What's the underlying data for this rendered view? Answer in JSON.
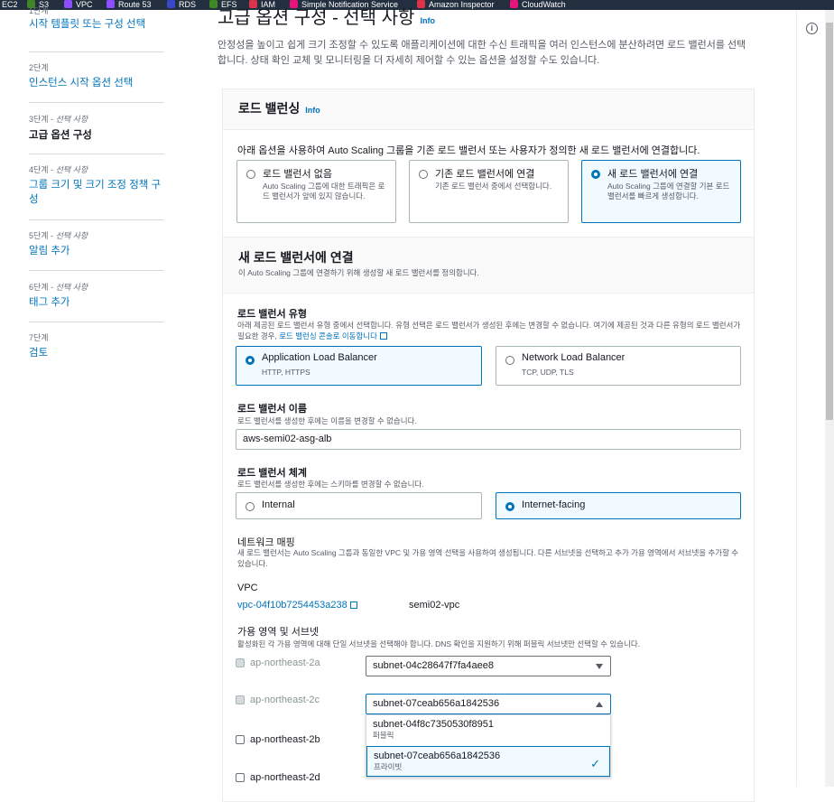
{
  "topbar": {
    "services": [
      {
        "name": "EC2",
        "color": "#ed7100"
      },
      {
        "name": "S3",
        "color": "#3f8624"
      },
      {
        "name": "VPC",
        "color": "#8c4fff"
      },
      {
        "name": "Route 53",
        "color": "#8c4fff"
      },
      {
        "name": "RDS",
        "color": "#3b48cc"
      },
      {
        "name": "EFS",
        "color": "#3f8624"
      },
      {
        "name": "IAM",
        "color": "#dd344c"
      },
      {
        "name": "Simple Notification Service",
        "color": "#e7157b"
      },
      {
        "name": "Amazon Inspector",
        "color": "#dd344c"
      },
      {
        "name": "CloudWatch",
        "color": "#e7157b"
      }
    ]
  },
  "sidebar": {
    "steps": [
      {
        "num": "1단계",
        "label": "시작 템플릿 또는 구성 선택"
      },
      {
        "num": "2단계",
        "label": "인스턴스 시작 옵션 선택"
      },
      {
        "num": "3단계 - ",
        "opt": "선택 사항",
        "label": "고급 옵션 구성"
      },
      {
        "num": "4단계 - ",
        "opt": "선택 사항",
        "label": "그룹 크기 및 크기 조정 정책 구성"
      },
      {
        "num": "5단계 - ",
        "opt": "선택 사항",
        "label": "알림 추가"
      },
      {
        "num": "6단계 - ",
        "opt": "선택 사항",
        "label": "태그 추가"
      },
      {
        "num": "7단계",
        "label": "검토"
      }
    ]
  },
  "main": {
    "title": "고급 옵션 구성 - 선택 사항",
    "info": "Info",
    "description": "안정성을 높이고 쉽게 크기 조정할 수 있도록 애플리케이션에 대한 수신 트래픽을 여러 인스턴스에 분산하려면 로드 밸런서를 선택합니다. 상태 확인 교체 및 모니터링을 더 자세히 제어할 수 있는 옵션을 설정할 수도 있습니다."
  },
  "lb_section": {
    "title": "로드 밸런싱",
    "info": "Info",
    "intro": "아래 옵션을 사용하여 Auto Scaling 그룹을 기존 로드 밸런서 또는 사용자가 정의한 새 로드 밸런서에 연결합니다.",
    "options": [
      {
        "title": "로드 밸런서 없음",
        "sub": "Auto Scaling 그룹에 대한 트래픽은 로드 밸런서가 앞에 있지 않습니다."
      },
      {
        "title": "기존 로드 밸런서에 연결",
        "sub": "기존 로드 밸런서 중에서 선택합니다."
      },
      {
        "title": "새 로드 밸런서에 연결",
        "sub": "Auto Scaling 그룹에 연결할 기본 로드 밸런서를 빠르게 생성합니다."
      }
    ]
  },
  "new_lb": {
    "title": "새 로드 밸런서에 연결",
    "desc": "이 Auto Scaling 그룹에 연결하기 위해 생성할 새 로드 밸런서를 정의합니다.",
    "type_label": "로드 밸런서 유형",
    "type_hint": "아래 제공된 로드 밸런서 유형 중에서 선택합니다. 유형 선택은 로드 밸런서가 생성된 후에는 변경할 수 없습니다. 여기에 제공된 것과 다른 유형의 로드 밸런서가 필요한 경우, ",
    "type_hint_link": "로드 밸런싱 콘솔로 이동합니다",
    "types": [
      {
        "title": "Application Load Balancer",
        "sub": "HTTP, HTTPS"
      },
      {
        "title": "Network Load Balancer",
        "sub": "TCP, UDP, TLS"
      }
    ],
    "name_label": "로드 밸런서 이름",
    "name_hint": "로드 밸런서를 생성한 후에는 이름을 변경할 수 없습니다.",
    "name_value": "aws-semi02-asg-alb",
    "scheme_label": "로드 밸런서 체계",
    "scheme_hint": "로드 밸런서를 생성한 후에는 스키마를 변경할 수 없습니다.",
    "schemes": [
      {
        "title": "Internal"
      },
      {
        "title": "Internet-facing"
      }
    ],
    "network_label": "네트워크 매핑",
    "network_hint": "새 로드 밸런서는 Auto Scaling 그룹과 동일한 VPC 및 가용 영역 선택을 사용하여 생성됩니다. 다른 서브넷을 선택하고 추가 가용 영역에서 서브넷을 추가할 수 있습니다.",
    "vpc_label": "VPC",
    "vpc_id": "vpc-04f10b7254453a238",
    "vpc_name": "semi02-vpc",
    "az_label": "가용 영역 및 서브넷",
    "az_hint": "활성화된 각 가용 영역에 대해 단일 서브넷을 선택해야 합니다. DNS 확인을 지원하기 위해 퍼블릭 서브넷만 선택할 수 있습니다.",
    "zones": [
      {
        "name": "ap-northeast-2a",
        "subnet": "subnet-04c28647f7fa4aee8"
      },
      {
        "name": "ap-northeast-2c",
        "subnet": "subnet-07ceab656a1842536"
      },
      {
        "name": "ap-northeast-2b"
      },
      {
        "name": "ap-northeast-2d"
      }
    ],
    "dropdown": [
      {
        "name": "subnet-04f8c7350530f8951",
        "tag": "퍼블릭"
      },
      {
        "name": "subnet-07ceab656a1842536",
        "tag": "프라이빗"
      }
    ]
  },
  "right_panel": {
    "icon": "info-icon"
  }
}
